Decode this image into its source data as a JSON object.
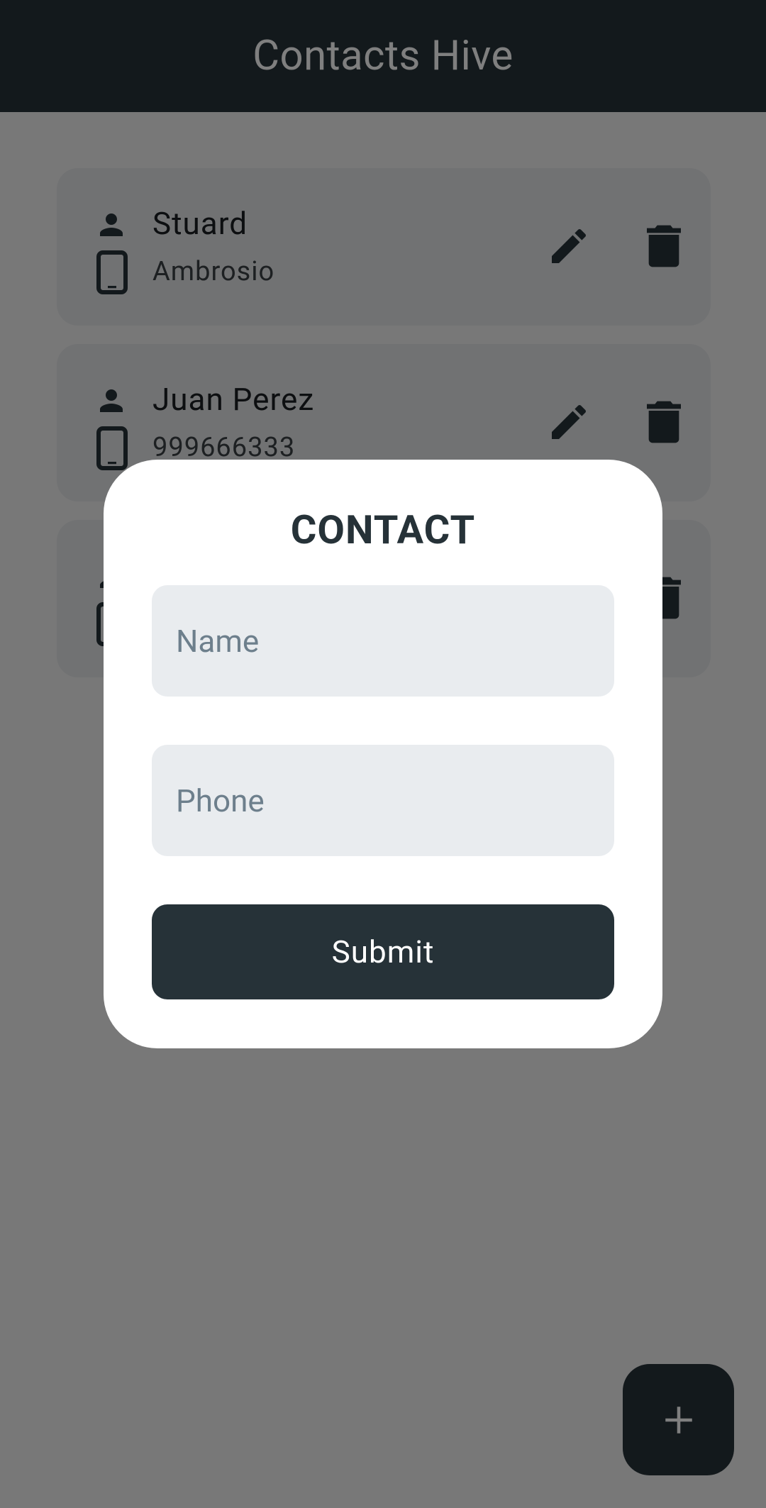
{
  "appbar": {
    "title": "Contacts Hive"
  },
  "contacts": [
    {
      "name": "Stuard",
      "phone": "Ambrosio"
    },
    {
      "name": "Juan Perez",
      "phone": "999666333"
    },
    {
      "name": "",
      "phone": ""
    }
  ],
  "dialog": {
    "title": "CONTACT",
    "name_placeholder": "Name",
    "phone_placeholder": "Phone",
    "name_value": "",
    "phone_value": "",
    "submit_label": "Submit"
  },
  "icons": {
    "person": "person-icon",
    "phone": "smartphone-icon",
    "edit": "pencil-icon",
    "delete": "trash-icon",
    "add": "plus-icon"
  },
  "colors": {
    "primary": "#263238",
    "card_bg": "#e2e4e6",
    "field_bg": "#e9ecef",
    "placeholder": "#6d7f8c"
  }
}
